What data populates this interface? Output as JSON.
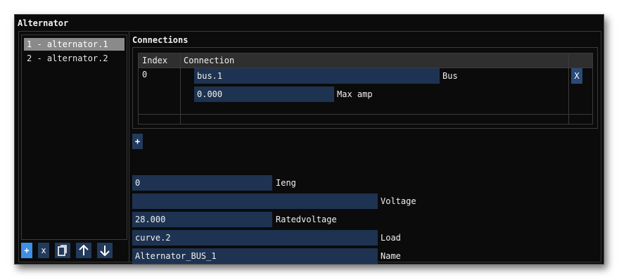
{
  "window": {
    "title": "Alternator"
  },
  "list": {
    "items": [
      {
        "label": "1 - alternator.1",
        "selected": true
      },
      {
        "label": "2 - alternator.2",
        "selected": false
      }
    ],
    "buttons": [
      {
        "label": "+",
        "icon": "plus-icon"
      },
      {
        "label": "x",
        "icon": "close-icon"
      },
      {
        "label": "",
        "icon": "copy-icon"
      },
      {
        "label": "",
        "icon": "arrow-up-icon"
      },
      {
        "label": "",
        "icon": "arrow-down-icon"
      }
    ]
  },
  "connections": {
    "label": "Connections",
    "columns": [
      "Index",
      "Connection"
    ],
    "rows": [
      {
        "index": "0",
        "bus_value": "bus.1",
        "bus_label": "Bus",
        "maxamp_value": "0.000",
        "maxamp_label": "Max amp",
        "delete_label": "X"
      }
    ],
    "add_label": "+"
  },
  "properties": [
    {
      "value": "0",
      "label": "Ieng"
    },
    {
      "value": "",
      "label": "Voltage"
    },
    {
      "value": "28.000",
      "label": "Ratedvoltage"
    },
    {
      "value": "curve.2",
      "label": "Load"
    },
    {
      "value": "Alternator_BUS_1",
      "label": "Name"
    }
  ],
  "colors": {
    "field_bg": "#1e3352",
    "button_bg": "#223a5c",
    "active_button": "#3f8ee8",
    "selected_item": "#8a8a8a",
    "window_bg": "#0b0b0b"
  }
}
